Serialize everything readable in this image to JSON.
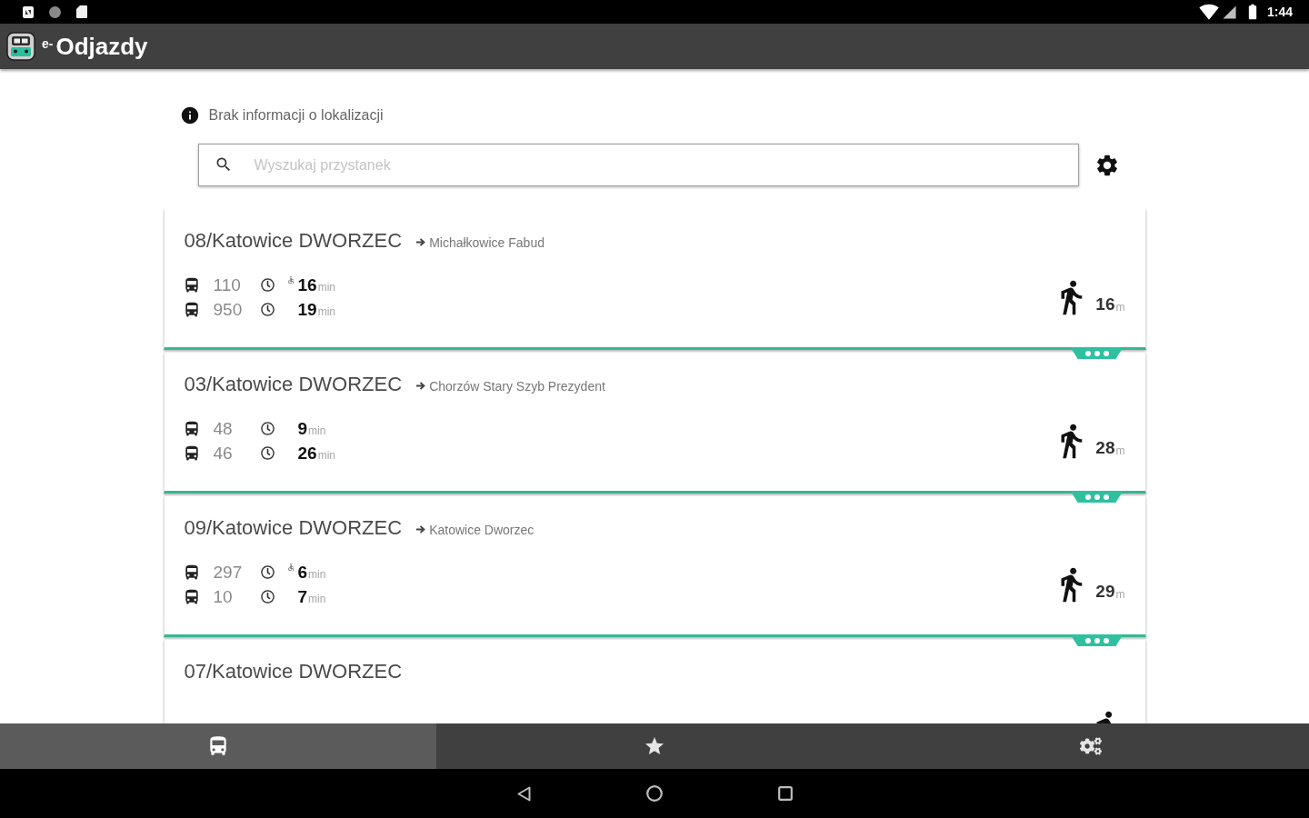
{
  "status_bar": {
    "time": "1:44"
  },
  "app_bar": {
    "title": "$^{e-}$Odjazdy"
  },
  "location_notice": "Brak informacji o lokalizacji",
  "search": {
    "placeholder": "Wyszukaj przystanek"
  },
  "stops": [
    {
      "name": "08/Katowice DWORZEC",
      "direction": "Michałkowice Fabud",
      "departures": [
        {
          "line": "110",
          "accessible": true,
          "minutes": "16",
          "unit": "min"
        },
        {
          "line": "950",
          "accessible": false,
          "minutes": "19",
          "unit": "min"
        }
      ],
      "distance": "16",
      "distance_unit": "m"
    },
    {
      "name": "03/Katowice DWORZEC",
      "direction": "Chorzów Stary Szyb Prezydent",
      "departures": [
        {
          "line": "48",
          "accessible": false,
          "minutes": "9",
          "unit": "min"
        },
        {
          "line": "46",
          "accessible": false,
          "minutes": "26",
          "unit": "min"
        }
      ],
      "distance": "28",
      "distance_unit": "m"
    },
    {
      "name": "09/Katowice DWORZEC",
      "direction": "Katowice Dworzec",
      "departures": [
        {
          "line": "297",
          "accessible": true,
          "minutes": "6",
          "unit": "min"
        },
        {
          "line": "10",
          "accessible": false,
          "minutes": "7",
          "unit": "min"
        }
      ],
      "distance": "29",
      "distance_unit": "m"
    },
    {
      "name": "07/Katowice DWORZEC"
    }
  ],
  "bottom_nav": [
    {
      "selected": true
    },
    {
      "selected": false
    },
    {
      "selected": false
    }
  ]
}
